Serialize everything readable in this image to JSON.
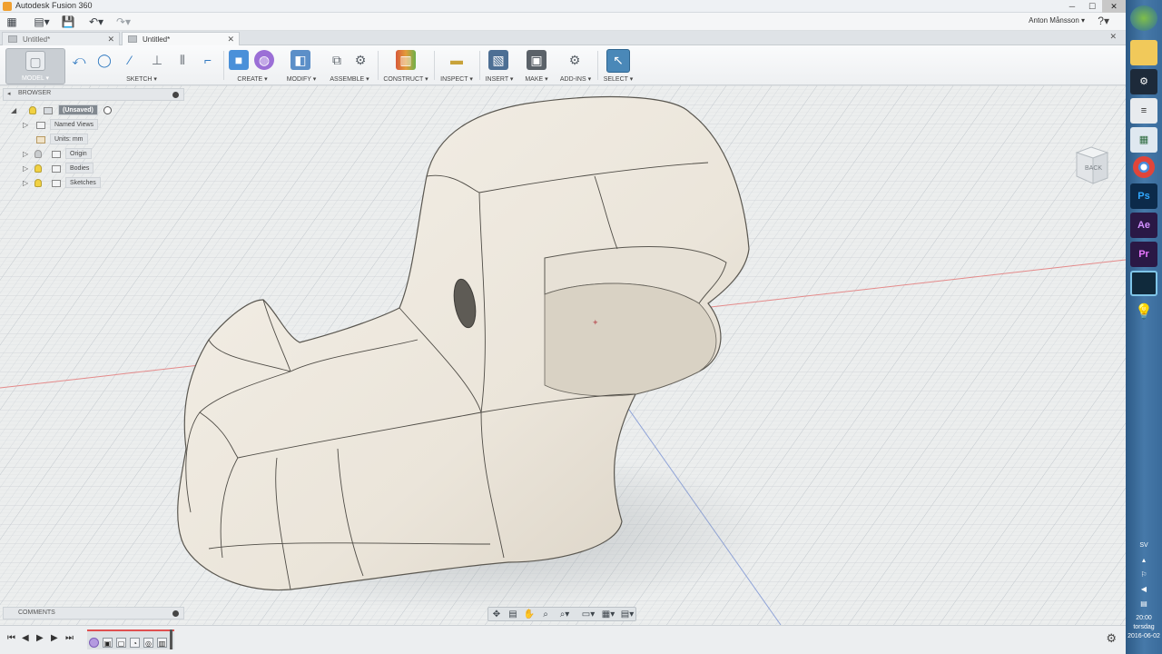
{
  "window": {
    "title": "Autodesk Fusion 360"
  },
  "quick_access": {
    "user": "Anton Månsson ▾",
    "help": "?▾"
  },
  "tabs": [
    {
      "label": "Untitled*",
      "active": false
    },
    {
      "label": "Untitled*",
      "active": true
    }
  ],
  "toolbar": {
    "workspace": "MODEL ▾",
    "groups": [
      {
        "label": "SKETCH ▾"
      },
      {
        "label": "CREATE ▾"
      },
      {
        "label": "MODIFY ▾"
      },
      {
        "label": "ASSEMBLE ▾"
      },
      {
        "label": "CONSTRUCT ▾"
      },
      {
        "label": "INSPECT ▾"
      },
      {
        "label": "INSERT ▾"
      },
      {
        "label": "MAKE ▾"
      },
      {
        "label": "ADD-INS ▾"
      },
      {
        "label": "SELECT ▾"
      }
    ]
  },
  "browser": {
    "title": "BROWSER",
    "root": "(Unsaved)",
    "items": [
      {
        "label": "Named Views"
      },
      {
        "label": "Units: mm"
      },
      {
        "label": "Origin"
      },
      {
        "label": "Bodies"
      },
      {
        "label": "Sketches"
      }
    ]
  },
  "viewcube": {
    "face": "BACK"
  },
  "comments": {
    "title": "COMMENTS"
  },
  "taskbar": {
    "language": "SV",
    "time": "20:00",
    "day": "torsdag",
    "date": "2016-06-02",
    "apps": [
      {
        "name": "chrome-icon",
        "label": ""
      },
      {
        "name": "photoshop-icon",
        "label": "Ps"
      },
      {
        "name": "after-effects-icon",
        "label": "Ae"
      },
      {
        "name": "premiere-icon",
        "label": "Pr"
      }
    ]
  },
  "colors": {
    "accent": "#4a88b8",
    "body": "#ebe6dc",
    "grid": "#cfd5d9",
    "taskbar": "#3a6b9b"
  }
}
